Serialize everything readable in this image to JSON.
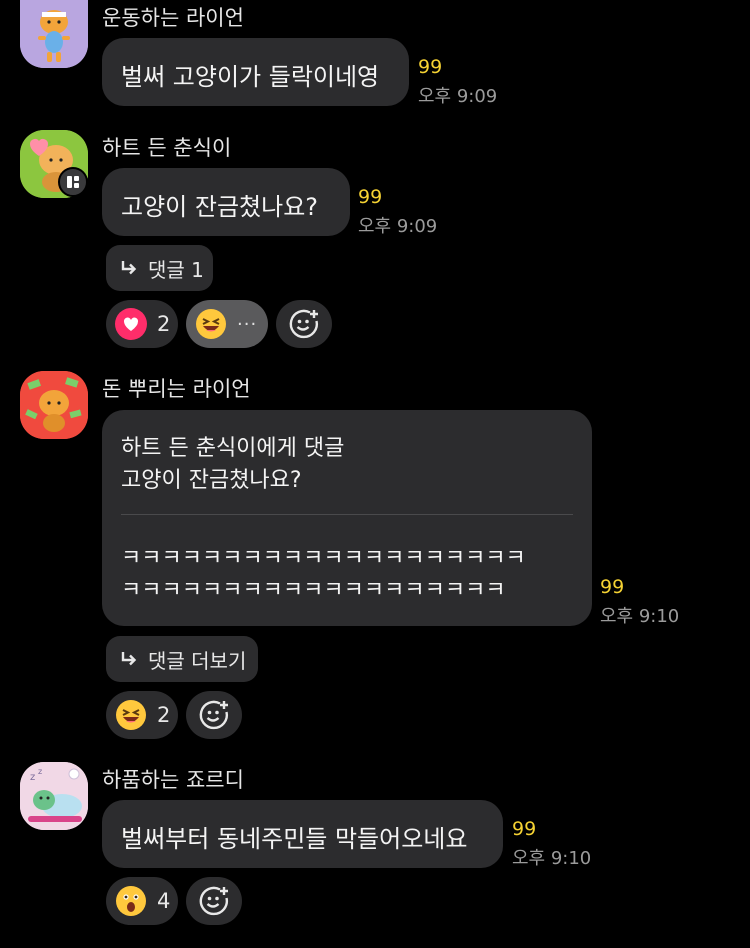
{
  "messages": [
    {
      "sender": "운동하는 라이언",
      "text": "벌써 고양이가 들락이네영",
      "unread": "99",
      "time": "오후 9:09"
    },
    {
      "sender": "하트 든 춘식이",
      "text": "고양이 잔금쳤나요?",
      "unread": "99",
      "time": "오후 9:09",
      "reply_label": "댓글 1",
      "reactions": [
        {
          "emoji": "heart-icon",
          "count": "2"
        },
        {
          "emoji": "grinning-squint-face-icon",
          "more": "···"
        }
      ]
    },
    {
      "sender": "돈 뿌리는 라이언",
      "quote_header": "하트 든 춘식이에게 댓글",
      "quote_text": "고양이 잔금쳤나요?",
      "text_line1": "ㅋㅋㅋㅋㅋㅋㅋㅋㅋㅋㅋㅋㅋㅋㅋㅋㅋㅋㅋㅋ",
      "text_line2": "ㅋㅋㅋㅋㅋㅋㅋㅋㅋㅋㅋㅋㅋㅋㅋㅋㅋㅋㅋ",
      "unread": "99",
      "time": "오후 9:10",
      "reply_label": "댓글 더보기",
      "reactions": [
        {
          "emoji": "grinning-squint-face-icon",
          "count": "2"
        }
      ]
    },
    {
      "sender": "하품하는 죠르디",
      "text": "벌써부터 동네주민들 막들어오네요",
      "unread": "99",
      "time": "오후 9:10",
      "reactions": [
        {
          "emoji": "astonished-face-icon",
          "count": "4"
        }
      ]
    }
  ],
  "colors": {
    "background": "#000000",
    "bubble": "#2c2c2e",
    "unread": "#f5d233",
    "time": "#9b9b9b",
    "heart": "#ff2d6a"
  }
}
